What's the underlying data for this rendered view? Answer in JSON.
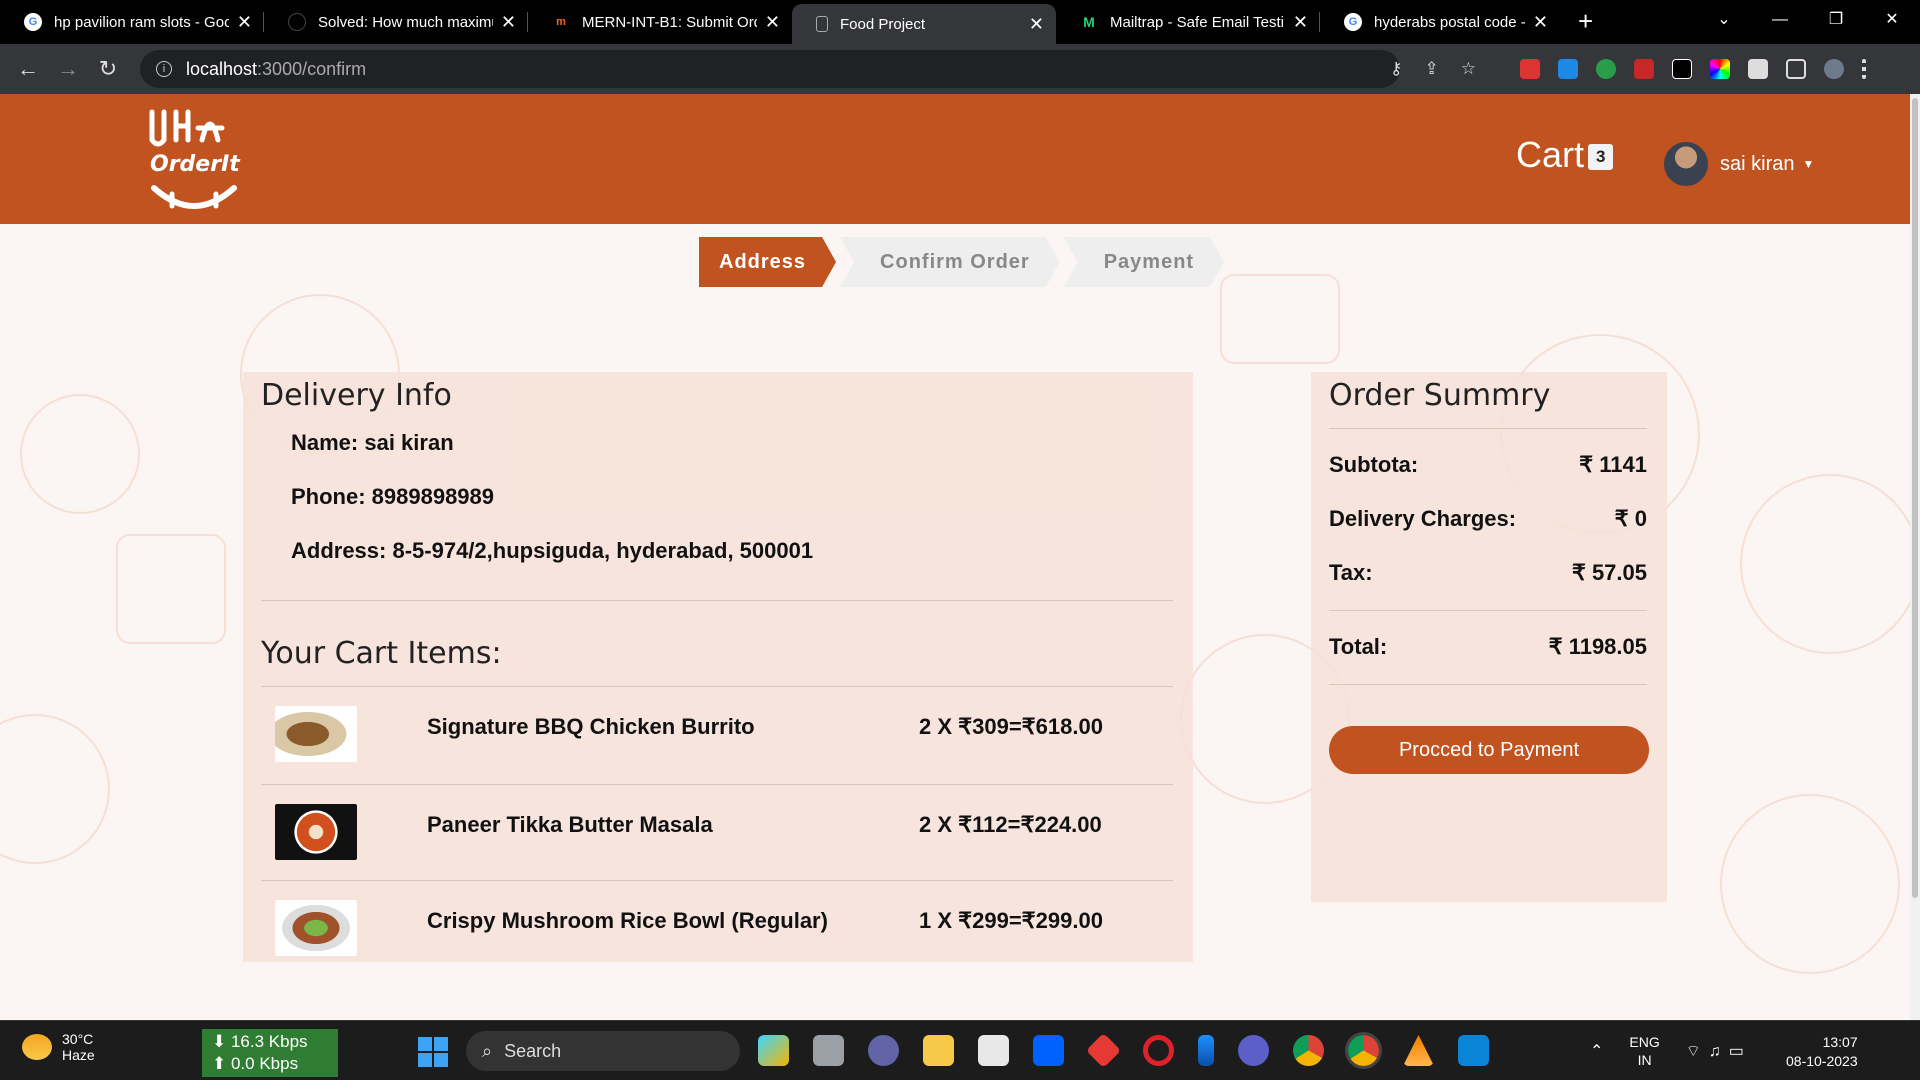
{
  "browser": {
    "tabs": [
      {
        "title": "hp pavilion ram slots - Goo",
        "icon": "google-icon",
        "color": "#4285f4"
      },
      {
        "title": "Solved: How much maximu",
        "icon": "hp-icon",
        "color": "#000000"
      },
      {
        "title": "MERN-INT-B1: Submit Ord",
        "icon": "masai-icon",
        "color": "#f26522"
      },
      {
        "title": "Food Project",
        "icon": "page-icon",
        "color": "#aaaaaa",
        "active": true
      },
      {
        "title": "Mailtrap - Safe Email Testir",
        "icon": "mailtrap-icon",
        "color": "#22d172"
      },
      {
        "title": "hyderabs postal code - Goo",
        "icon": "google-icon",
        "color": "#4285f4"
      }
    ],
    "close_glyph": "✕",
    "new_tab": "+",
    "url_host": "localhost",
    "url_path": ":3000/confirm"
  },
  "header": {
    "logo_text": "OrderIt",
    "cart_label": "Cart",
    "cart_count": "3",
    "user_name": "sai kiran"
  },
  "steps": [
    "Address",
    "Confirm Order",
    "Payment"
  ],
  "delivery": {
    "title": "Delivery Info",
    "name": "Name: sai kiran",
    "phone": "Phone: 8989898989",
    "address": "Address: 8-5-974/2,hupsiguda, hyderabad, 500001"
  },
  "cart": {
    "title": "Your Cart Items:",
    "items": [
      {
        "name": "Signature BBQ Chicken Burrito",
        "price": "2 X ₹309=₹618.00"
      },
      {
        "name": "Paneer Tikka Butter Masala",
        "price": "2 X ₹112=₹224.00"
      },
      {
        "name": "Crispy Mushroom Rice Bowl (Regular)",
        "price": "1 X ₹299=₹299.00"
      }
    ]
  },
  "summary": {
    "title": "Order Summry",
    "subtotal_label": "Subtota:",
    "subtotal_value": "₹ 1141",
    "delivery_label": "Delivery Charges:",
    "delivery_value": "₹ 0",
    "tax_label": "Tax:",
    "tax_value": "₹ 57.05",
    "total_label": "Total:",
    "total_value": "₹ 1198.05",
    "button": "Procced to Payment"
  },
  "taskbar": {
    "temp": "30°C",
    "weather": "Haze",
    "down_speed": "⬇ 16.3 Kbps",
    "up_speed": "⬆ 0.0 Kbps",
    "search": "Search",
    "lang1": "ENG",
    "lang2": "IN",
    "time": "13:07",
    "date": "08-10-2023"
  },
  "colors": {
    "brand": "#c0531f",
    "badge_bg": "#f3f3f3",
    "card_bg": "#f6e2d8"
  }
}
